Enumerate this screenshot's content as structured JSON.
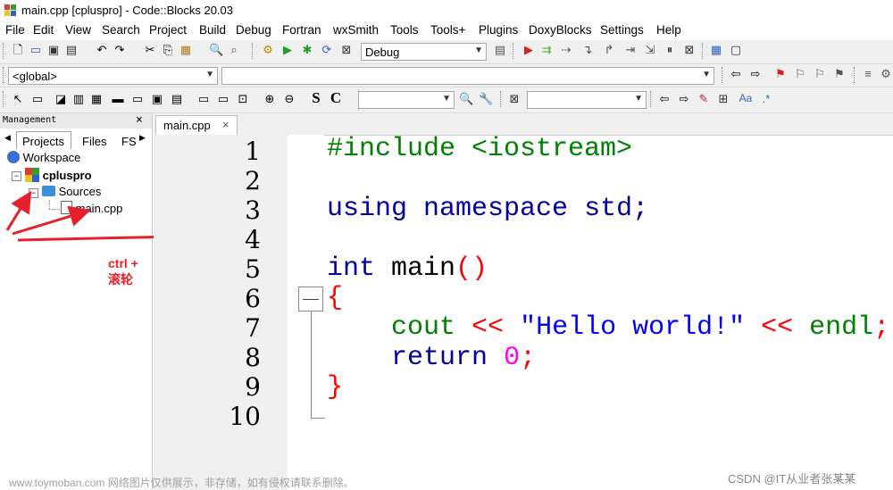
{
  "window": {
    "title": "main.cpp [cpluspro] - Code::Blocks 20.03"
  },
  "menu": [
    "File",
    "Edit",
    "View",
    "Search",
    "Project",
    "Build",
    "Debug",
    "Fortran",
    "wxSmith",
    "Tools",
    "Tools+",
    "Plugins",
    "DoxyBlocks",
    "Settings",
    "Help"
  ],
  "toolbar": {
    "build_target": "Debug",
    "scope": "<global>"
  },
  "management": {
    "title": "Management",
    "close": "×",
    "tabs": [
      "Projects",
      "Files",
      "FS"
    ],
    "tree": {
      "workspace": "Workspace",
      "project": "cpluspro",
      "folder": "Sources",
      "file": "main.cpp"
    }
  },
  "editor": {
    "tab_label": "main.cpp",
    "tab_close": "×",
    "line_numbers": [
      "1",
      "2",
      "3",
      "4",
      "5",
      "6",
      "7",
      "8",
      "9",
      "10"
    ],
    "code": {
      "l1_directive": "#include <iostream>",
      "l3_kw1": "using",
      "l3_kw2": "namespace",
      "l3_rest": "std;",
      "l5_kw": "int",
      "l5_name": "main",
      "l5_parens": "()",
      "l6": "{",
      "l7_cout": "cout",
      "l7_op1": "<<",
      "l7_str": "\"Hello world!\"",
      "l7_op2": "<<",
      "l7_endl": "endl",
      "l7_semi": ";",
      "l8_kw": "return",
      "l8_num": "0",
      "l8_semi": ";",
      "l9": "}"
    }
  },
  "annotation": {
    "label": "ctrl + 滚轮",
    "color": "#e8202a"
  },
  "watermarks": {
    "left": "www.toymoban.com 网络图片仅供展示，非存储，如有侵权请联系删除。",
    "right": "CSDN @IT从业者张某某"
  },
  "colors": {
    "keyword": "#0000a0",
    "preprocessor": "#008000",
    "string": "#0000ff",
    "number": "#ff00ff",
    "brace": "#ff0000"
  }
}
